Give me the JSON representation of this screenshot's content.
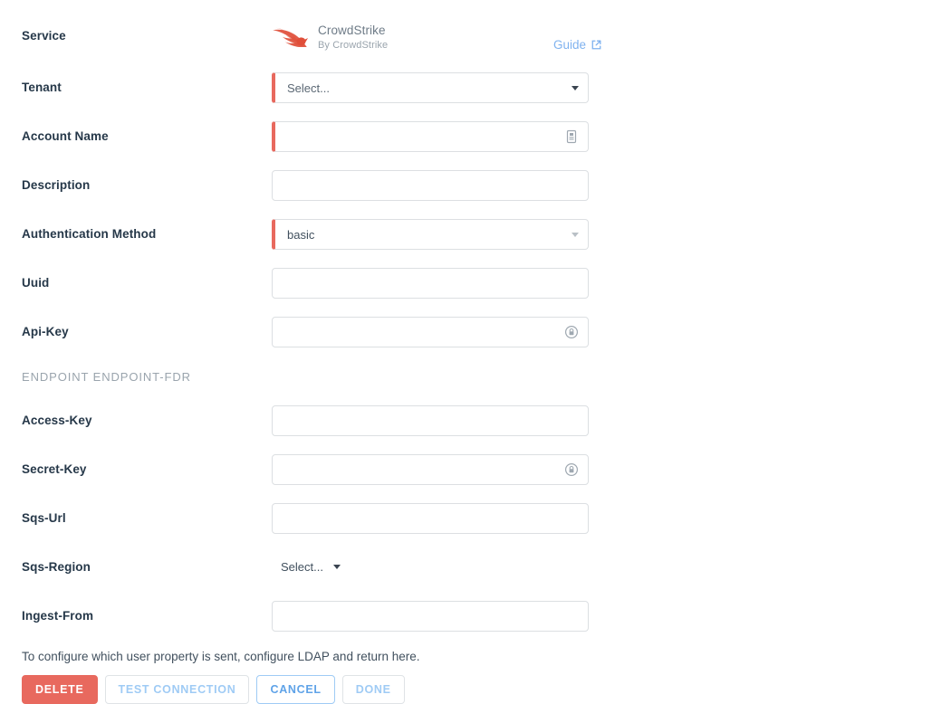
{
  "service": {
    "label": "Service",
    "name": "CrowdStrike",
    "vendor": "By CrowdStrike",
    "logo_icon": "crowdstrike-falcon-logo",
    "guide_label": "Guide",
    "guide_icon": "external-link-icon"
  },
  "fields": [
    {
      "label": "Tenant",
      "type": "select",
      "value": "Select...",
      "required": true,
      "icon": "chevron-down-icon",
      "name": "tenant"
    },
    {
      "label": "Account Name",
      "type": "text",
      "value": "",
      "required": true,
      "icon": "suggest-list-icon",
      "name": "account-name"
    },
    {
      "label": "Description",
      "type": "text",
      "value": "",
      "required": false,
      "icon": "",
      "name": "description"
    },
    {
      "label": "Authentication Method",
      "type": "select",
      "value": "basic",
      "required": true,
      "icon": "chevron-down-icon",
      "name": "authentication-method"
    },
    {
      "label": "Uuid",
      "type": "text",
      "value": "",
      "required": false,
      "icon": "",
      "name": "uuid"
    },
    {
      "label": "Api-Key",
      "type": "password",
      "value": "",
      "required": false,
      "icon": "lock-circle-icon",
      "name": "api-key"
    }
  ],
  "section": {
    "title": "ENDPOINT ENDPOINT-FDR"
  },
  "endpoint_fields": [
    {
      "label": "Access-Key",
      "type": "text",
      "value": "",
      "required": false,
      "icon": "",
      "name": "access-key"
    },
    {
      "label": "Secret-Key",
      "type": "password",
      "value": "",
      "required": false,
      "icon": "lock-circle-icon",
      "name": "secret-key"
    },
    {
      "label": "Sqs-Url",
      "type": "text",
      "value": "",
      "required": false,
      "icon": "",
      "name": "sqs-url"
    },
    {
      "label": "Sqs-Region",
      "type": "inline-select",
      "value": "Select...",
      "required": false,
      "icon": "chevron-down-icon",
      "name": "sqs-region"
    },
    {
      "label": "Ingest-From",
      "type": "text",
      "value": "",
      "required": false,
      "icon": "",
      "name": "ingest-from"
    }
  ],
  "footer": {
    "helper_text": "To configure which user property is sent, configure LDAP and return here.",
    "buttons": [
      {
        "label": "DELETE",
        "style": "danger",
        "disabled": false,
        "name": "delete-button"
      },
      {
        "label": "TEST CONNECTION",
        "style": "disabled",
        "disabled": true,
        "name": "test-connection-button"
      },
      {
        "label": "CANCEL",
        "style": "outline-primary",
        "disabled": false,
        "name": "cancel-button"
      },
      {
        "label": "DONE",
        "style": "disabled",
        "disabled": true,
        "name": "done-button"
      }
    ]
  },
  "colors": {
    "required_accent": "#e8695e",
    "danger": "#e8695e",
    "link": "#7fb2ef",
    "label": "#263849",
    "muted": "#9aa4ad",
    "border": "#dcdfe2"
  }
}
